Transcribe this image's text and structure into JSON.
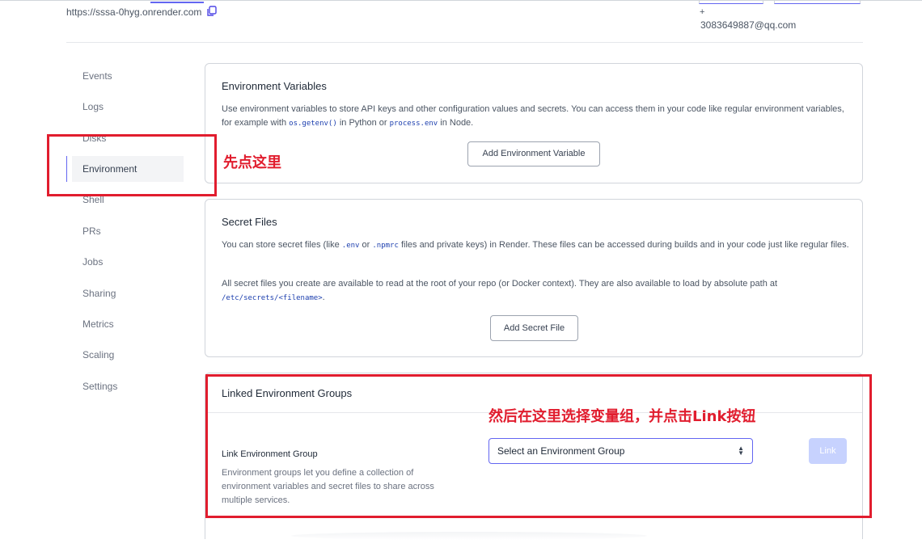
{
  "header": {
    "url": "https://sssa-0hyg.onrender.com",
    "plus": "+",
    "email": "3083649887@qq.com"
  },
  "sidebar": {
    "items": [
      {
        "label": "Events"
      },
      {
        "label": "Logs"
      },
      {
        "label": "Disks"
      },
      {
        "label": "Environment",
        "active": true
      },
      {
        "label": "Shell"
      },
      {
        "label": "PRs"
      },
      {
        "label": "Jobs"
      },
      {
        "label": "Sharing"
      },
      {
        "label": "Metrics"
      },
      {
        "label": "Scaling"
      },
      {
        "label": "Settings"
      }
    ]
  },
  "env_vars": {
    "title": "Environment Variables",
    "desc_1": "Use environment variables to store API keys and other configuration values and secrets. You can access them in your code like regular environment variables, for example with ",
    "code_1": "os.getenv()",
    "desc_2": " in Python or ",
    "code_2": "process.env",
    "desc_3": " in Node.",
    "button": "Add Environment Variable"
  },
  "secret_files": {
    "title": "Secret Files",
    "p1_a": "You can store secret files (like ",
    "p1_code1": ".env",
    "p1_b": " or ",
    "p1_code2": ".npmrc",
    "p1_c": " files and private keys) in Render. These files can be accessed during builds and in your code just like regular files.",
    "p2_a": "All secret files you create are available to read at the root of your repo (or Docker context). They are also available to load by absolute path at ",
    "p2_code": "/etc/secrets/<filename>",
    "p2_b": ".",
    "button": "Add Secret File"
  },
  "linked_groups": {
    "title": "Linked Environment Groups",
    "label": "Link Environment Group",
    "desc": "Environment groups let you define a collection of environment variables and secret files to share across multiple services.",
    "select_value": "Select an Environment Group",
    "link_button": "Link"
  },
  "annotations": {
    "first": "先点这里",
    "second": "然后在这里选择变量组，并点击Link按钮",
    "color": "#e11d2e"
  },
  "icons": {
    "copy": "copy-icon",
    "select_arrows": "chevron-updown-icon"
  }
}
